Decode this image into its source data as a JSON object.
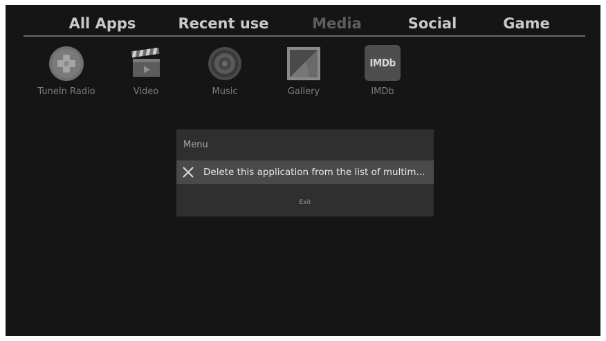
{
  "tabs": [
    {
      "label": "All Apps",
      "active": false
    },
    {
      "label": "Recent use",
      "active": false
    },
    {
      "label": "Media",
      "active": true
    },
    {
      "label": "Social",
      "active": false
    },
    {
      "label": "Game",
      "active": false
    }
  ],
  "apps": [
    {
      "label": "TuneIn Radio",
      "icon": "tunein-radio-icon"
    },
    {
      "label": "Video",
      "icon": "clapperboard-icon"
    },
    {
      "label": "Music",
      "icon": "speaker-icon"
    },
    {
      "label": "Gallery",
      "icon": "picture-icon"
    },
    {
      "label": "IMDb",
      "icon": "imdb-icon",
      "icon_text": "IMDb"
    }
  ],
  "dialog": {
    "title": "Menu",
    "item_label": "Delete this application from the list of multim...",
    "item_icon": "close-icon",
    "exit_label": "Exit"
  },
  "colors": {
    "background": "#151515",
    "dialog_bg": "#2f2f2f",
    "highlight": "#4a4a4a",
    "tab_text": "#c9c9c9",
    "tab_selected_text": "#5e5e5e"
  }
}
